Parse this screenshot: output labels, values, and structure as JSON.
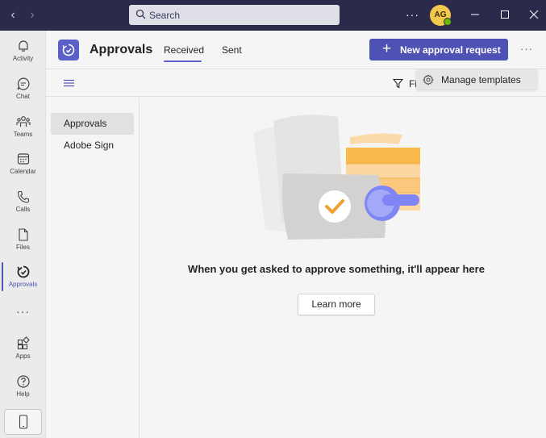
{
  "titlebar": {
    "search_placeholder": "Search",
    "avatar_initials": "AG",
    "presence_color": "#6bb700",
    "accent": "#2b2a4b"
  },
  "rail": {
    "items": [
      {
        "label": "Activity",
        "icon": "bell-icon"
      },
      {
        "label": "Chat",
        "icon": "chat-icon"
      },
      {
        "label": "Teams",
        "icon": "teams-icon"
      },
      {
        "label": "Calendar",
        "icon": "calendar-icon"
      },
      {
        "label": "Calls",
        "icon": "phone-icon"
      },
      {
        "label": "Files",
        "icon": "file-icon"
      },
      {
        "label": "Approvals",
        "icon": "approvals-icon",
        "active": true
      },
      {
        "label": "Apps",
        "icon": "apps-icon"
      },
      {
        "label": "Help",
        "icon": "help-icon"
      }
    ]
  },
  "header": {
    "title": "Approvals",
    "tabs": [
      {
        "label": "Received",
        "active": true
      },
      {
        "label": "Sent"
      }
    ],
    "new_button_label": "New approval request",
    "brand_color": "#4f52b2"
  },
  "toolbar": {
    "filter_label": "Fi",
    "menu_item_label": "Manage templates"
  },
  "nav": {
    "items": [
      {
        "label": "Approvals",
        "selected": true
      },
      {
        "label": "Adobe Sign"
      }
    ]
  },
  "main": {
    "empty_message": "When you get asked to approve something, it'll appear here",
    "learn_more_label": "Learn more"
  }
}
